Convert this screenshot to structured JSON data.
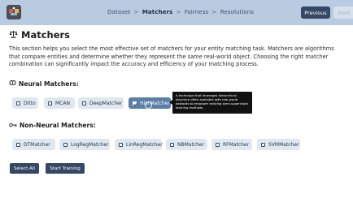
{
  "header": {
    "breadcrumb": [
      {
        "label": "Dataset",
        "active": false
      },
      {
        "label": "Matchers",
        "active": true
      },
      {
        "label": "Fairness",
        "active": false
      },
      {
        "label": "Resolutions",
        "active": false
      }
    ],
    "breadcrumb_separator": ">",
    "previous_label": "Previous",
    "next_label": "Next"
  },
  "page": {
    "title": "Matchers",
    "title_icon": "scale-icon",
    "description": "This section helps you select the most effective set of matchers for your entity matching task. Matchers are algorithms that compare entities and determine whether they represent the same real-world object. Choosing the right matcher combination can significantly impact the accuracy and efficiency of your matching process."
  },
  "neural": {
    "heading": "Neural Matchers:",
    "icon": "brain-icon",
    "items": [
      {
        "label": "Ditto",
        "checked": false
      },
      {
        "label": "MCAN",
        "checked": false
      },
      {
        "label": "DeepMatcher",
        "checked": false
      },
      {
        "label": "HierMatcher",
        "checked": true
      }
    ],
    "tooltip": "A technique that leverages hierarchical structure often available with real-world datasets to empower existing semi-supervised learning methods."
  },
  "non_neural": {
    "heading": "Non-Neural Matchers:",
    "icon": "key-icon",
    "items": [
      {
        "label": "DTMatcher",
        "checked": false
      },
      {
        "label": "LogRegMatcher",
        "checked": false
      },
      {
        "label": "LinRegMatcher",
        "checked": false
      },
      {
        "label": "NBMatcher",
        "checked": false
      },
      {
        "label": "RFMatcher",
        "checked": false
      },
      {
        "label": "SVMMatcher",
        "checked": false
      }
    ]
  },
  "actions": {
    "select_all": "Select All",
    "start_training": "Start Training"
  },
  "colors": {
    "header_bg": "#b9cbe0",
    "primary": "#344866",
    "chip_bg": "#dfe8f1",
    "chip_selected": "#5b7fa6"
  }
}
